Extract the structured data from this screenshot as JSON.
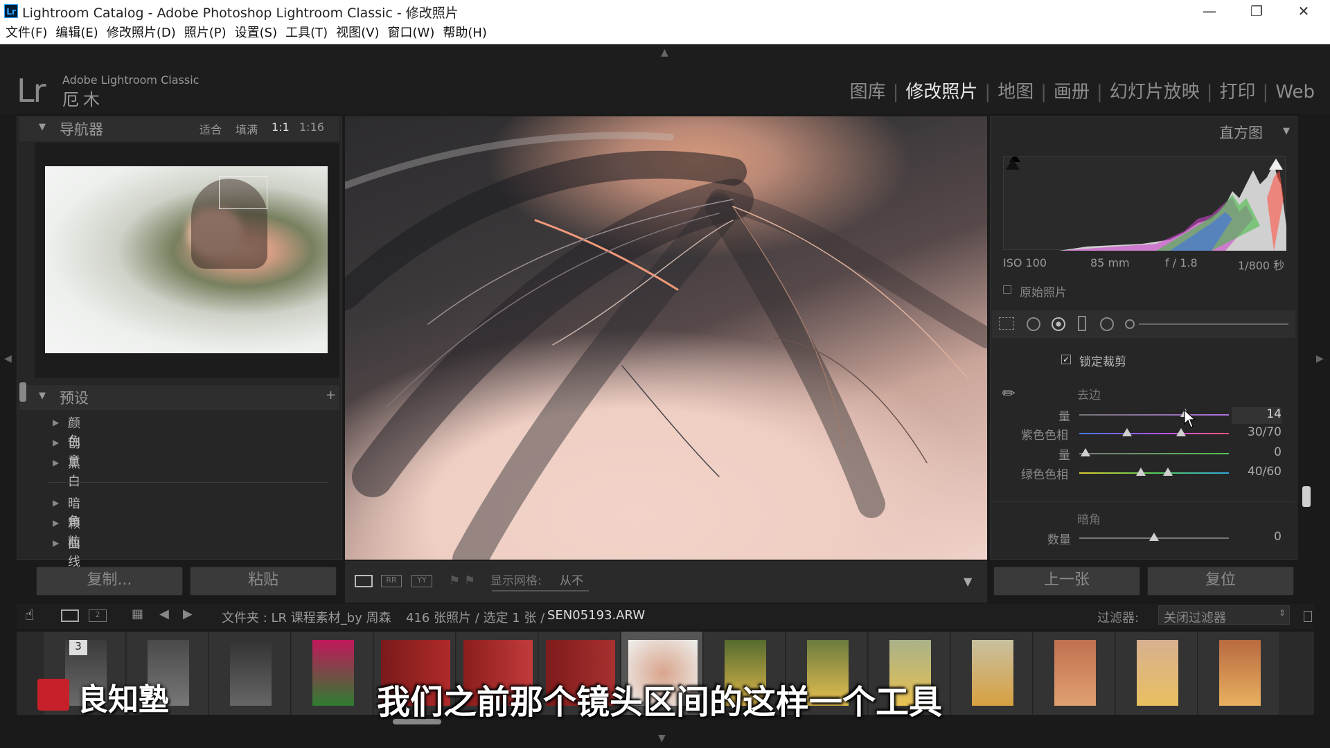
{
  "titlebar": {
    "app_title": "Lightroom Catalog - Adobe Photoshop Lightroom Classic - 修改照片",
    "icon": "Lr",
    "minimize": "—",
    "maximize": "❐",
    "close": "✕"
  },
  "menu": [
    "文件(F)",
    "编辑(E)",
    "修改照片(D)",
    "照片(P)",
    "设置(S)",
    "工具(T)",
    "视图(V)",
    "窗口(W)",
    "帮助(H)"
  ],
  "identity": {
    "logo": "Lr",
    "product": "Adobe Lightroom Classic",
    "user": "厄木"
  },
  "modules": [
    "图库",
    "修改照片",
    "地图",
    "画册",
    "幻灯片放映",
    "打印",
    "Web"
  ],
  "navigator": {
    "title": "导航器",
    "zoom": [
      "适合",
      "填满",
      "1:1",
      "1:16"
    ]
  },
  "presets": {
    "title": "预设",
    "add": "+",
    "group1": [
      "颜色",
      "创意",
      "黑白"
    ],
    "group2": [
      "暗角",
      "颗粒",
      "曲线"
    ]
  },
  "left_buttons": {
    "copy": "复制...",
    "paste": "粘贴"
  },
  "toolbar": {
    "grid_label": "显示网格:",
    "grid_value": "从不"
  },
  "histogram": {
    "title": "直方图",
    "iso": "ISO 100",
    "focal": "85 mm",
    "aperture": "f / 1.8",
    "shutter": "1/800 秒",
    "original": "原始照片"
  },
  "lens": {
    "lock_crop": "锁定裁剪",
    "defringe": "去边",
    "amount_label": "量",
    "amount_value": "14",
    "purple_hue_label": "紫色色相",
    "purple_hue_value": "30/70",
    "green_amount_label": "量",
    "green_amount_value": "0",
    "green_hue_label": "绿色色相",
    "green_hue_value": "40/60",
    "vignette": "暗角",
    "vig_amount_label": "数量",
    "vig_amount_value": "0"
  },
  "right_buttons": {
    "prev": "上一张",
    "reset": "复位"
  },
  "filmbar": {
    "folder": "文件夹 : LR 课程素材_by 周森",
    "count": "416 张照片 / 选定 1 张 /",
    "filename": "SEN05193.ARW",
    "filter_label": "过滤器:",
    "filter_value": "关闭过滤器",
    "badge": "3"
  },
  "overlay": {
    "subtitle": "我们之前那个镜头区间的这样一个工具",
    "watermark": "良知塾"
  }
}
